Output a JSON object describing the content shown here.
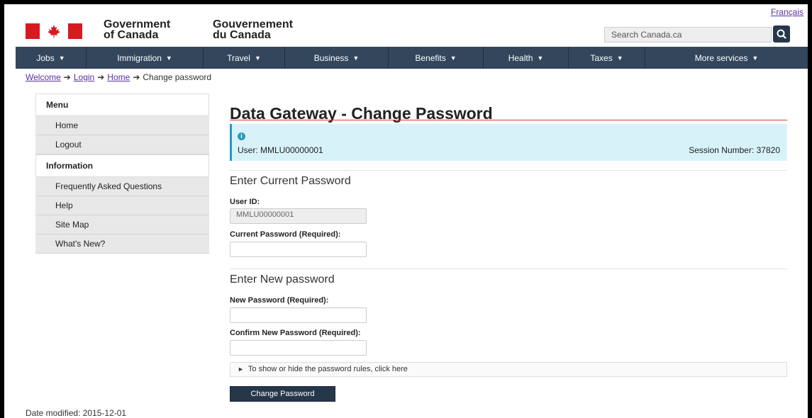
{
  "header": {
    "language_link": "Français",
    "wordmark_en_1": "Government",
    "wordmark_en_2": "of Canada",
    "wordmark_fr_1": "Gouvernement",
    "wordmark_fr_2": "du Canada",
    "search_placeholder": "Search Canada.ca",
    "flag_color": "#d71920"
  },
  "nav": {
    "items": [
      "Jobs",
      "Immigration",
      "Travel",
      "Business",
      "Benefits",
      "Health",
      "Taxes",
      "More services"
    ],
    "bg_color": "#33465c"
  },
  "breadcrumb": {
    "items": [
      "Welcome",
      "Login",
      "Home",
      "Change password"
    ]
  },
  "sidebar": {
    "menu_heading": "Menu",
    "menu_items": [
      "Home",
      "Logout"
    ],
    "info_heading": "Information",
    "info_items": [
      "Frequently Asked Questions",
      "Help",
      "Site Map",
      "What's New?"
    ]
  },
  "main": {
    "title": "Data Gateway - Change Password",
    "info_user": "User: MMLU00000001",
    "info_session": "Session Number: 37820",
    "section1_title": "Enter Current Password",
    "user_id_label": "User ID:",
    "user_id_value": "MMLU00000001",
    "current_pw_label": "Current Password (Required):",
    "section2_title": "Enter New password",
    "new_pw_label": "New Password (Required):",
    "confirm_pw_label": "Confirm New Password (Required):",
    "rules_toggle": "To show or hide the password rules, click here",
    "submit_label": "Change Password"
  },
  "footer": {
    "date_modified": "Date modified: 2015-12-01"
  }
}
